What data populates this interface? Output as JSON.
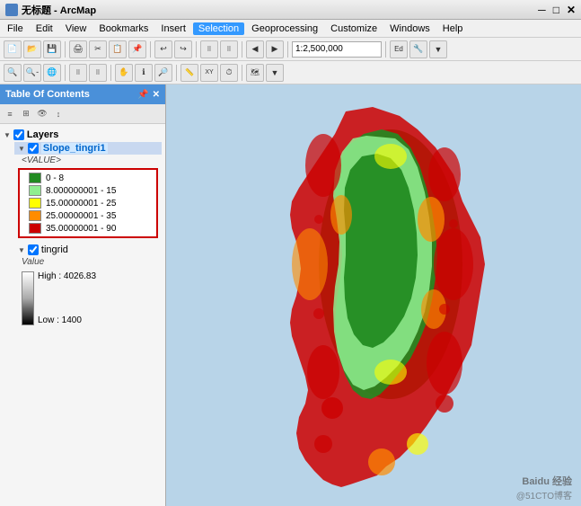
{
  "titleBar": {
    "title": "无标题 - ArcMap",
    "icon": "arcmap-icon"
  },
  "menuBar": {
    "items": [
      {
        "label": "File",
        "active": false
      },
      {
        "label": "Edit",
        "active": false
      },
      {
        "label": "View",
        "active": false
      },
      {
        "label": "Bookmarks",
        "active": false
      },
      {
        "label": "Insert",
        "active": true
      },
      {
        "label": "Selection",
        "active": false
      },
      {
        "label": "Geoprocessing",
        "active": false
      },
      {
        "label": "Customize",
        "active": false
      },
      {
        "label": "Windows",
        "active": false
      },
      {
        "label": "Help",
        "active": false
      }
    ]
  },
  "toc": {
    "title": "Table Of Contents",
    "layers_label": "Layers",
    "layer1": {
      "name": "Slope_tingri1",
      "value_label": "<VALUE>",
      "legend": [
        {
          "color": "#228B22",
          "label": "0 - 8"
        },
        {
          "color": "#90EE90",
          "label": "8.000000001 - 15"
        },
        {
          "color": "#FFFF00",
          "label": "15.00000001 - 25"
        },
        {
          "color": "#FF8C00",
          "label": "25.00000001 - 35"
        },
        {
          "color": "#CC0000",
          "label": "35.00000001 - 90"
        }
      ]
    },
    "layer2": {
      "name": "tingrid",
      "value_label": "Value",
      "high_label": "High : 4026.83",
      "low_label": "Low : 1400"
    }
  },
  "watermark": {
    "baidu": "Baidu 经验",
    "cto": "@51CTO博客"
  }
}
